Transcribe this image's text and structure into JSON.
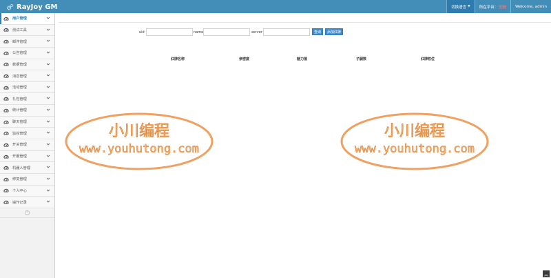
{
  "navbar": {
    "title": "RayJoy GM",
    "language_menu": "切换语言",
    "platform_label": "所在平台：",
    "platform_value": "无效",
    "welcome": "Welcome, admin"
  },
  "sidebar": {
    "items": [
      {
        "label": "用户管理",
        "active": true
      },
      {
        "label": "测试工具"
      },
      {
        "label": "邮件管理"
      },
      {
        "label": "公告管理"
      },
      {
        "label": "数据管理"
      },
      {
        "label": "消息管理"
      },
      {
        "label": "活动管理"
      },
      {
        "label": "礼包管理"
      },
      {
        "label": "统计管理"
      },
      {
        "label": "聊天管理"
      },
      {
        "label": "监控管理"
      },
      {
        "label": "开关管理"
      },
      {
        "label": "开服管理"
      },
      {
        "label": "机器人管理"
      },
      {
        "label": "修复管理"
      },
      {
        "label": "个人中心"
      },
      {
        "label": "操作记录"
      }
    ],
    "collapse_icon": "double-chevron-left-icon"
  },
  "search": {
    "uid_label": "uid",
    "name_label": "name",
    "server_label": "server",
    "search_button": "查询",
    "add_button": "添加红牌"
  },
  "table": {
    "headers": [
      "红牌名称",
      "亲密度",
      "魅力值",
      "子嗣数",
      "红牌权位"
    ]
  },
  "watermark": {
    "line1": "小川编程",
    "line2": "www.youhutong.com"
  },
  "colors": {
    "navbar": "#438eb9",
    "accent": "#2b7dbc",
    "button": "#428bca",
    "watermark": "#f0a060"
  }
}
